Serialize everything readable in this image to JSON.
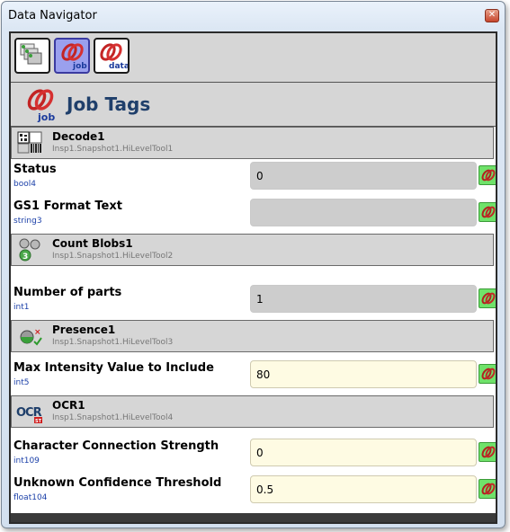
{
  "window": {
    "title": "Data Navigator"
  },
  "header": {
    "label": "Job Tags"
  },
  "toolbar": {
    "buttons": [
      "images-icon",
      "job-link-icon",
      "data-link-icon"
    ]
  },
  "tools": [
    {
      "name": "Decode1",
      "path": "Insp1.Snapshot1.HiLevelTool1",
      "icon": "barcode-icon",
      "properties": [
        {
          "label": "Status",
          "type": "bool4",
          "value": "0",
          "editable": false
        },
        {
          "label": "GS1 Format Text",
          "type": "string3",
          "value": "",
          "editable": false
        }
      ]
    },
    {
      "name": "Count Blobs1",
      "path": "Insp1.Snapshot1.HiLevelTool2",
      "icon": "blobs-icon",
      "properties": [
        {
          "label": "Number of parts",
          "type": "int1",
          "value": "1",
          "editable": false
        }
      ]
    },
    {
      "name": "Presence1",
      "path": "Insp1.Snapshot1.HiLevelTool3",
      "icon": "presence-icon",
      "properties": [
        {
          "label": "Max Intensity Value to Include",
          "type": "int5",
          "value": "80",
          "editable": true
        }
      ]
    },
    {
      "name": "OCR1",
      "path": "Insp1.Snapshot1.HiLevelTool4",
      "icon": "ocr-icon",
      "properties": [
        {
          "label": "Character Connection Strength",
          "type": "int109",
          "value": "0",
          "editable": true
        },
        {
          "label": "Unknown Confidence Threshold",
          "type": "float104",
          "value": "0.5",
          "editable": true
        }
      ]
    }
  ],
  "colors": {
    "accent": "#9aa0ee",
    "link_green": "#6fe26a",
    "editable_bg": "#fefbe3",
    "readonly_bg": "#cdcdcd"
  }
}
